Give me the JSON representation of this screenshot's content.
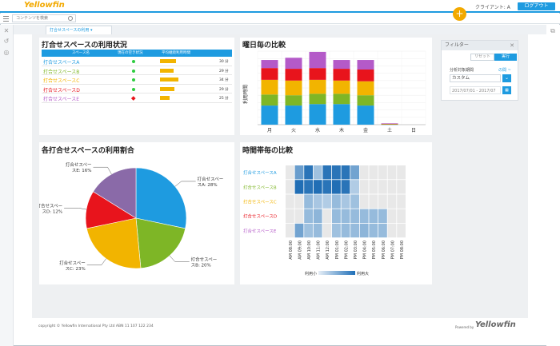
{
  "app": {
    "logo": "Yellowfin",
    "client": "クライアント: A",
    "logout_label": "ログアウト",
    "plus_label": "+"
  },
  "search": {
    "placeholder": "コンテンツを検索"
  },
  "tab": {
    "label": "打合せスペースの利用"
  },
  "filter": {
    "title": "フィルター",
    "reset_label": "リセット",
    "apply_label": "実行",
    "field_label": "分析対象期間",
    "operator": "の間 ~",
    "selected": "カスタム",
    "date_range": "2017/07/01 - 2017/07"
  },
  "table_panel": {
    "title": "打合せスペースの利用状況",
    "headers": [
      "スペース名",
      "現在の空き状況",
      "平均継続利用時間"
    ],
    "rows": [
      {
        "name": "打合せスペースA",
        "color": "#1e9be0",
        "status": "green",
        "bar": 0.85,
        "value": "30 分"
      },
      {
        "name": "打合せスペースB",
        "color": "#7eb626",
        "status": "green",
        "bar": 0.7,
        "value": "29 分"
      },
      {
        "name": "打合せスペースC",
        "color": "#f2b400",
        "status": "green",
        "bar": 0.95,
        "value": "34 分"
      },
      {
        "name": "打合せスペースD",
        "color": "#e8141c",
        "status": "green",
        "bar": 0.75,
        "value": "29 分"
      },
      {
        "name": "打合せスペースE",
        "color": "#b45ac8",
        "status": "red",
        "bar": 0.52,
        "value": "25 分"
      }
    ]
  },
  "chart_data": [
    {
      "type": "bar",
      "title": "曜日毎の比較",
      "ylabel": "利用時間",
      "categories": [
        "月",
        "火",
        "水",
        "木",
        "金",
        "土",
        "日"
      ],
      "series": [
        {
          "color": "#1e9be0",
          "values": [
            26,
            26,
            28,
            28,
            26,
            0.4,
            0
          ]
        },
        {
          "color": "#7eb626",
          "values": [
            15,
            14,
            14,
            14,
            14,
            0.3,
            0
          ]
        },
        {
          "color": "#f2b400",
          "values": [
            20,
            20,
            19,
            18,
            19,
            0.4,
            0
          ]
        },
        {
          "color": "#e8141c",
          "values": [
            16,
            16,
            16,
            16,
            16,
            0.3,
            0
          ]
        },
        {
          "color": "#b45ac8",
          "values": [
            11,
            15,
            22,
            12,
            13,
            0.4,
            0
          ]
        }
      ],
      "ylim": [
        0,
        100
      ],
      "grid": true
    },
    {
      "type": "pie",
      "title": "各打合せスペースの利用割合",
      "categories": [
        "打合せスペースA",
        "打合せスペースB",
        "打合せスペースC",
        "打合せスペースD",
        "打合せスペースE"
      ],
      "labels": [
        "打合せスペー\nスA: 28%",
        "打合せスペー\nスB: 20%",
        "打合せスペー\nスC: 23%",
        "打合せスペー\nスD: 12%",
        "打合せスペー\nスE: 16%"
      ],
      "values": [
        28,
        20,
        23,
        12,
        16
      ],
      "colors": [
        "#1e9be0",
        "#7eb626",
        "#f2b400",
        "#e8141c",
        "#8a6aa8"
      ]
    },
    {
      "type": "heatmap",
      "title": "時間帯毎の比較",
      "rows": [
        "打合せスペースA",
        "打合せスペースB",
        "打合せスペースC",
        "打合せスペースD",
        "打合せスペースE"
      ],
      "row_colors": [
        "#1e9be0",
        "#7eb626",
        "#f2b400",
        "#e8141c",
        "#b45ac8"
      ],
      "columns": [
        "AM 08:00",
        "AM 09:00",
        "AM 10:00",
        "AM 11:00",
        "AM 12:00",
        "PM 01:00",
        "PM 02:00",
        "PM 03:00",
        "PM 04:00",
        "PM 05:00",
        "PM 06:00",
        "PM 07:00",
        "PM 08:00"
      ],
      "values": [
        [
          0,
          0.55,
          0.9,
          0.25,
          0.9,
          0.9,
          0.9,
          0.5,
          0,
          0,
          0,
          0,
          0
        ],
        [
          0,
          0.95,
          0.9,
          0.95,
          0.9,
          0.95,
          0.9,
          0.15,
          0,
          0,
          0,
          0,
          0
        ],
        [
          0,
          0,
          0.3,
          0.2,
          0.15,
          0.3,
          0.2,
          0.25,
          0,
          0,
          0,
          0,
          0
        ],
        [
          0,
          0,
          0.3,
          0.35,
          0,
          0.3,
          0.3,
          0.3,
          0.3,
          0.3,
          0.3,
          0,
          0
        ],
        [
          0,
          0.5,
          0.25,
          0.3,
          0,
          0.25,
          0.3,
          0.3,
          0.35,
          0.3,
          0.3,
          0,
          0
        ]
      ],
      "legend": {
        "low": "利用小",
        "high": "利用大"
      }
    }
  ],
  "footer": {
    "copyright": "copyright © Yellowfin International Pty Ltd ABN 11 107 122 234",
    "powered_by": "Powered by",
    "logo": "Yellowfin"
  }
}
